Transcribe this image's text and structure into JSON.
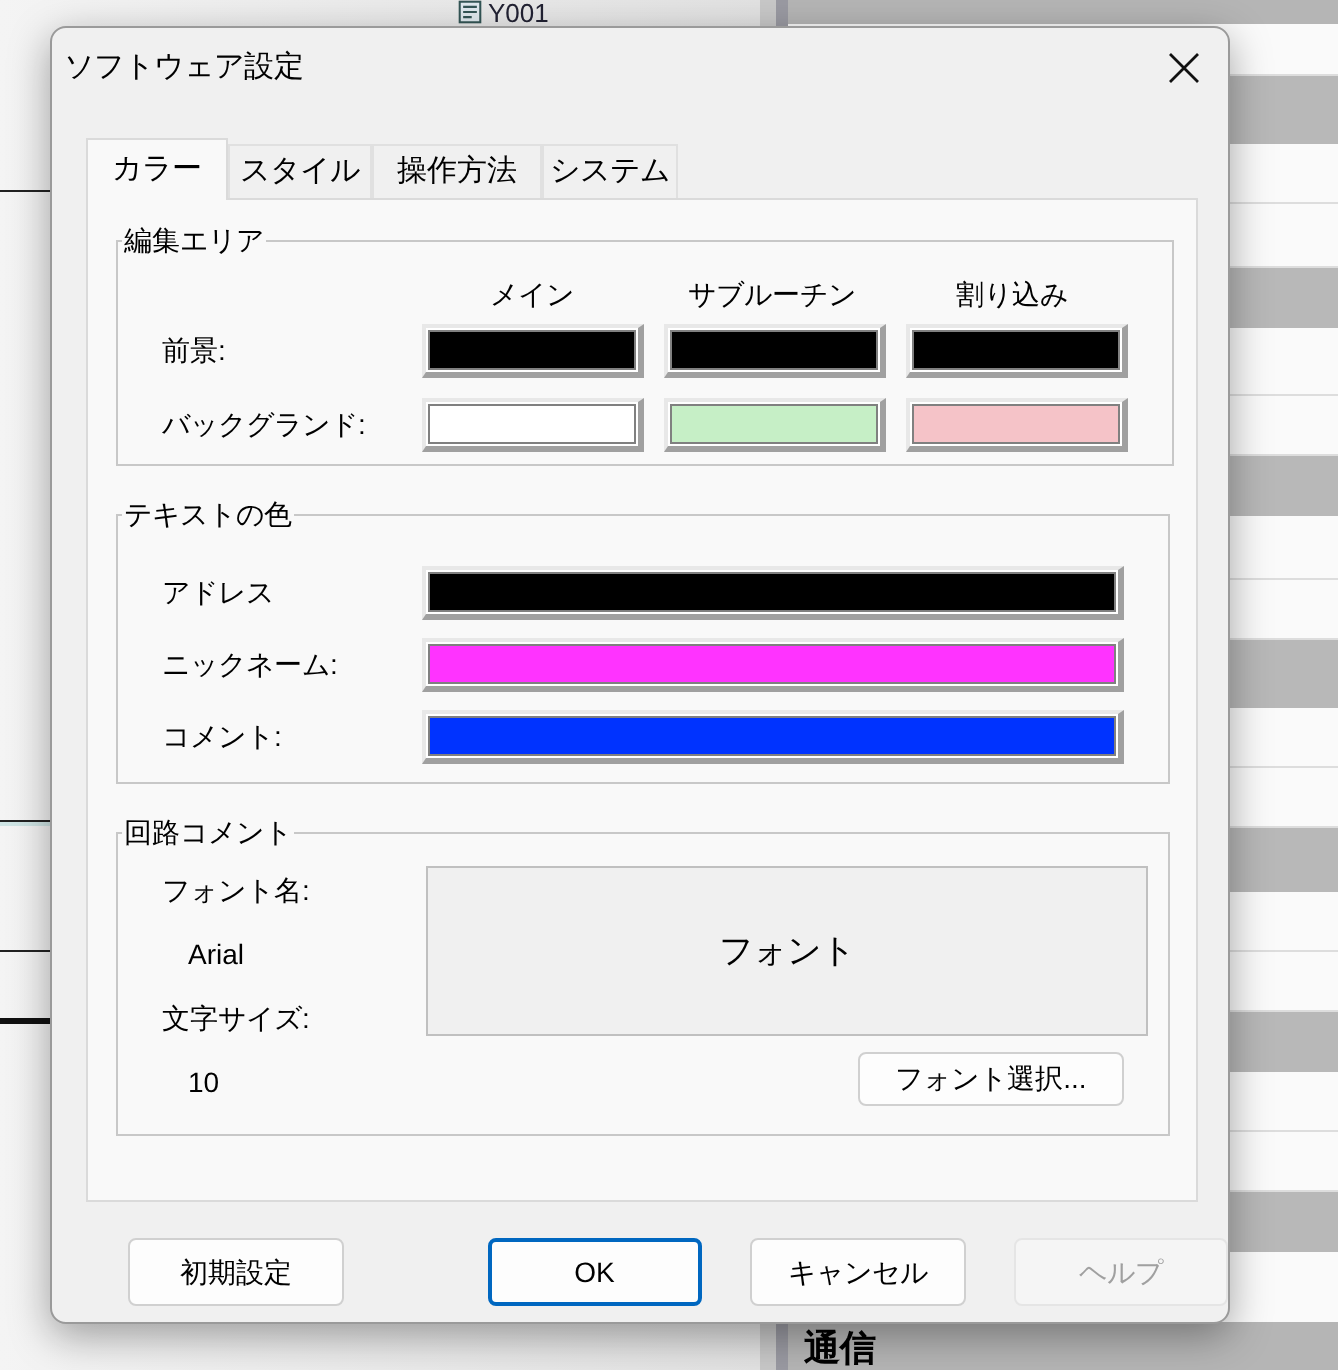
{
  "background": {
    "left_label": "Y001",
    "right_footer": "通信"
  },
  "dialog": {
    "title": "ソフトウェア設定",
    "tabs": [
      {
        "label": "カラー",
        "selected": true
      },
      {
        "label": "スタイル",
        "selected": false
      },
      {
        "label": "操作方法",
        "selected": false
      },
      {
        "label": "システム",
        "selected": false
      }
    ],
    "edit_area": {
      "title": "編集エリア",
      "columns": [
        "メイン",
        "サブルーチン",
        "割り込み"
      ],
      "rows": [
        {
          "label": "前景:",
          "swatches": [
            {
              "color": "#000000"
            },
            {
              "color": "#000000"
            },
            {
              "color": "#000000"
            }
          ]
        },
        {
          "label": "バックグランド:",
          "swatches": [
            {
              "color": "#ffffff"
            },
            {
              "color": "#c6efc6"
            },
            {
              "color": "#f5c3c8"
            }
          ]
        }
      ]
    },
    "text_colors": {
      "title": "テキストの色",
      "rows": [
        {
          "label": "アドレス",
          "color": "#000000"
        },
        {
          "label": "ニックネーム:",
          "color": "#ff33ff"
        },
        {
          "label": "コメント:",
          "color": "#0033ff"
        }
      ]
    },
    "circuit_comment": {
      "title": "回路コメント",
      "font_name_label": "フォント名:",
      "font_name": "Arial",
      "font_size_label": "文字サイズ:",
      "font_size": "10",
      "preview": "フォント",
      "select_button": "フォント選択..."
    },
    "buttons": [
      {
        "label": "初期設定",
        "focused": false,
        "disabled": false
      },
      {
        "label": "OK",
        "focused": true,
        "disabled": false
      },
      {
        "label": "キャンセル",
        "focused": false,
        "disabled": false
      },
      {
        "label": "ヘルプ",
        "focused": false,
        "disabled": true
      }
    ]
  }
}
